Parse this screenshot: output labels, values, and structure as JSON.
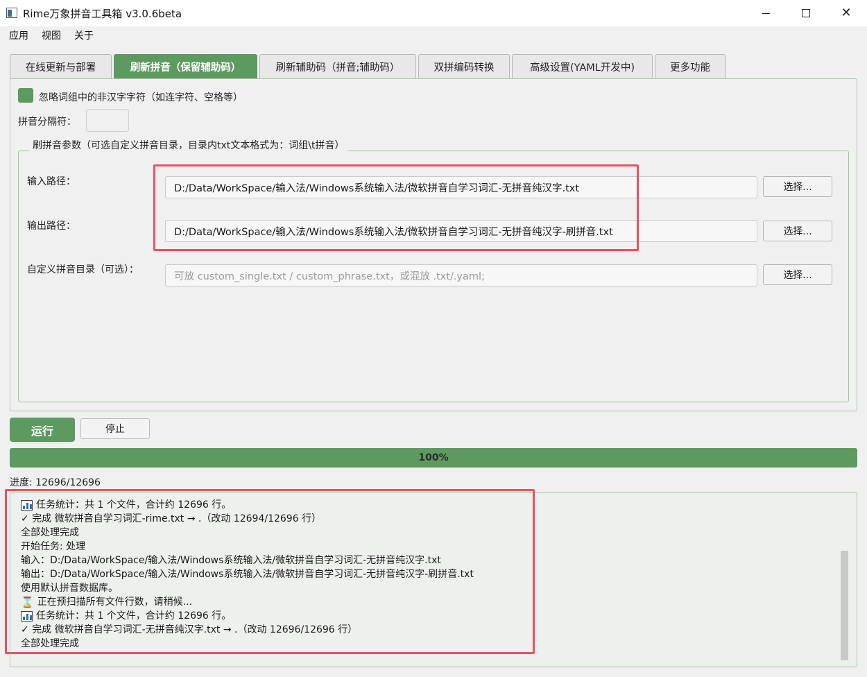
{
  "window": {
    "title": "Rime万象拼音工具箱 v3.0.6beta",
    "icons": {
      "app": "app-icon",
      "minimize": "minimize-icon",
      "maximize": "maximize-icon",
      "close": "close-icon"
    }
  },
  "menu": {
    "items": [
      "应用",
      "视图",
      "关于"
    ]
  },
  "tabs": [
    {
      "label": "在线更新与部署",
      "active": false
    },
    {
      "label": "刷新拼音（保留辅助码）",
      "active": true
    },
    {
      "label": "刷新辅助码（拼音;辅助码）",
      "active": false
    },
    {
      "label": "双拼编码转换",
      "active": false
    },
    {
      "label": "高级设置(YAML开发中)",
      "active": false
    },
    {
      "label": "更多功能",
      "active": false
    }
  ],
  "options": {
    "ignore_nonhanzi_label": "忽略词组中的非汉字字符（如连字符、空格等）",
    "ignore_nonhanzi_checked": true,
    "separator_label": "拼音分隔符：",
    "separator_value": ""
  },
  "params": {
    "group_title": "刷拼音参数（可选自定义拼音目录，目录内txt文本格式为：词组\\t拼音）",
    "input_label": "输入路径：",
    "input_value": "D:/Data/WorkSpace/输入法/Windows系统输入法/微软拼音自学习词汇-无拼音纯汉字.txt",
    "output_label": "输出路径：",
    "output_value": "D:/Data/WorkSpace/输入法/Windows系统输入法/微软拼音自学习词汇-无拼音纯汉字-刷拼音.txt",
    "custom_label": "自定义拼音目录（可选）：",
    "custom_placeholder": "可放 custom_single.txt / custom_phrase.txt，或混放 .txt/.yaml;",
    "choose_label": "选择..."
  },
  "actions": {
    "run_label": "运行",
    "stop_label": "停止"
  },
  "progress": {
    "percent_text": "100%",
    "fraction": 1.0,
    "count_text": "进度: 12696/12696"
  },
  "log": {
    "lines": [
      {
        "icon": "bar-chart-icon",
        "text": "任务统计：共 1 个文件，合计约 12696 行。"
      },
      {
        "icon": "",
        "text": "✓ 完成 微软拼音自学习词汇-rime.txt → .（改动 12694/12696 行）"
      },
      {
        "icon": "",
        "text": "全部处理完成"
      },
      {
        "icon": "",
        "text": "开始任务: 处理"
      },
      {
        "icon": "",
        "text": "输入：D:/Data/WorkSpace/输入法/Windows系统输入法/微软拼音自学习词汇-无拼音纯汉字.txt"
      },
      {
        "icon": "",
        "text": "输出：D:/Data/WorkSpace/输入法/Windows系统输入法/微软拼音自学习词汇-无拼音纯汉字-刷拼音.txt"
      },
      {
        "icon": "",
        "text": "使用默认拼音数据库。"
      },
      {
        "icon": "hourglass-icon",
        "text": "正在预扫描所有文件行数，请稍候..."
      },
      {
        "icon": "bar-chart-icon",
        "text": "任务统计：共 1 个文件，合计约 12696 行。"
      },
      {
        "icon": "",
        "text": "✓ 完成 微软拼音自学习词汇-无拼音纯汉字.txt → .（改动 12696/12696 行）"
      },
      {
        "icon": "",
        "text": "全部处理完成"
      }
    ]
  },
  "colors": {
    "accent": "#5d9a60",
    "highlight": "#ef4f5f",
    "background": "#f0f0f0"
  }
}
